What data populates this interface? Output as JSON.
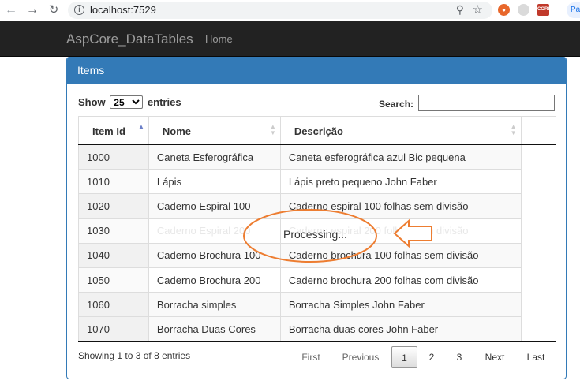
{
  "browser": {
    "url": "localhost:7529",
    "back_icon": "arrow-left-icon",
    "forward_icon": "arrow-right-icon",
    "reload_icon": "reload-icon",
    "profile_label": "Pa"
  },
  "navbar": {
    "brand": "AspCore_DataTables",
    "links": [
      "Home"
    ]
  },
  "panel": {
    "title": "Items",
    "color": "#337ab7"
  },
  "length": {
    "show_label": "Show",
    "value": "25",
    "entries_label": "entries"
  },
  "search": {
    "label": "Search:",
    "value": ""
  },
  "table": {
    "headers": [
      "Item Id",
      "Nome",
      "Descrição"
    ],
    "rows": [
      [
        "1000",
        "Caneta Esferográfica",
        "Caneta esferográfica azul Bic pequena"
      ],
      [
        "1010",
        "Lápis",
        "Lápis preto pequeno John Faber"
      ],
      [
        "1020",
        "Caderno Espiral 100",
        "Caderno espiral 100 folhas sem divisão"
      ],
      [
        "1030",
        "Caderno Espiral 200",
        "Caderno espiral 200 folhas com divisão"
      ],
      [
        "1040",
        "Caderno Brochura 100",
        "Caderno brochura 100 folhas sem divisão"
      ],
      [
        "1050",
        "Caderno Brochura 200",
        "Caderno brochura 200 folhas com divisão"
      ],
      [
        "1060",
        "Borracha simples",
        "Borracha Simples John Faber"
      ],
      [
        "1070",
        "Borracha Duas Cores",
        "Borracha duas cores John Faber"
      ]
    ]
  },
  "processing": "Processing...",
  "annotation_color": "#ed7d31",
  "info": "Showing 1 to 3 of 8 entries",
  "pagination": {
    "first": "First",
    "previous": "Previous",
    "pages": [
      "1",
      "2",
      "3"
    ],
    "current": "1",
    "next": "Next",
    "last": "Last"
  }
}
